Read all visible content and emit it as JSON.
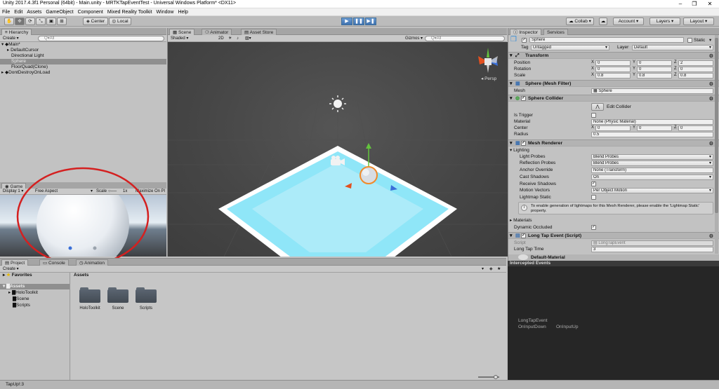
{
  "window": {
    "title": "Unity 2017.4.3f1 Personal (64bit) - Main.unity - MRTKTapEventTest - Universal Windows Platform* <DX11>"
  },
  "menu": [
    "File",
    "Edit",
    "Assets",
    "GameObject",
    "Component",
    "Mixed Reality Toolkit",
    "Window",
    "Help"
  ],
  "toolbar": {
    "center": "Center",
    "local": "Local",
    "collab": "Collab",
    "account": "Account",
    "layers": "Layers",
    "layout": "Layout"
  },
  "hierarchy": {
    "tab": "Hierarchy",
    "create": "Create",
    "search_placeholder": "Q▾All",
    "items": [
      {
        "label": "Main*",
        "indent": 0,
        "expanded": true
      },
      {
        "label": "DefaultCursor",
        "indent": 1,
        "collapsed": true
      },
      {
        "label": "Directional Light",
        "indent": 1
      },
      {
        "label": "Sphere",
        "indent": 1,
        "selected": true
      },
      {
        "label": "FloorQuad(Clone)",
        "indent": 1
      },
      {
        "label": "DontDestroyOnLoad",
        "indent": 0,
        "collapsed": true
      }
    ]
  },
  "scene": {
    "tabs": [
      "Scene",
      "Animator",
      "Asset Store"
    ],
    "shaded": "Shaded",
    "mode2d": "2D",
    "gizmos": "Gizmos",
    "search_placeholder": "Q▾All",
    "persp": "Persp"
  },
  "game": {
    "tab": "Game",
    "display": "Display 1",
    "aspect": "Free Aspect",
    "scale_label": "Scale",
    "scale_value": "1x",
    "maximize": "Maximize On Pl"
  },
  "project": {
    "tabs": [
      "Project",
      "Console",
      "Animation"
    ],
    "create": "Create",
    "favorites": "Favorites",
    "assets": "Assets",
    "tree": [
      "HoloToolkit",
      "Scene",
      "Scripts"
    ],
    "breadcrumb": "Assets",
    "folders": [
      "HoloToolkit",
      "Scene",
      "Scripts"
    ]
  },
  "inspector": {
    "tabs": [
      "Inspector",
      "Services"
    ],
    "object_name": "Sphere",
    "static_label": "Static",
    "tag_label": "Tag",
    "tag_value": "Untagged",
    "layer_label": "Layer",
    "layer_value": "Default",
    "transform": {
      "title": "Transform",
      "position": {
        "label": "Position",
        "x": "0",
        "y": "0",
        "z": "2"
      },
      "rotation": {
        "label": "Rotation",
        "x": "0",
        "y": "0",
        "z": "0"
      },
      "scale": {
        "label": "Scale",
        "x": "0.8",
        "y": "0.8",
        "z": "0.8"
      }
    },
    "mesh_filter": {
      "title": "Sphere (Mesh Filter)",
      "mesh_label": "Mesh",
      "mesh_value": "Sphere"
    },
    "sphere_collider": {
      "title": "Sphere Collider",
      "edit_collider": "Edit Collider",
      "is_trigger": "Is Trigger",
      "material_label": "Material",
      "material_value": "None (Physic Material)",
      "center_label": "Center",
      "center": {
        "x": "0",
        "y": "0",
        "z": "0"
      },
      "radius_label": "Radius",
      "radius_value": "0.5"
    },
    "mesh_renderer": {
      "title": "Mesh Renderer",
      "lighting": "Lighting",
      "light_probes_label": "Light Probes",
      "light_probes_value": "Blend Probes",
      "reflection_probes_label": "Reflection Probes",
      "reflection_probes_value": "Blend Probes",
      "anchor_override_label": "Anchor Override",
      "anchor_override_value": "None (Transform)",
      "cast_shadows_label": "Cast Shadows",
      "cast_shadows_value": "On",
      "receive_shadows_label": "Receive Shadows",
      "motion_vectors_label": "Motion Vectors",
      "motion_vectors_value": "Per Object Motion",
      "lightmap_static_label": "Lightmap Static",
      "info": "To enable generation of lightmaps for this Mesh Renderer, please enable the 'Lightmap Static' property.",
      "materials": "Materials",
      "dynamic_occluded": "Dynamic Occluded"
    },
    "long_tap": {
      "title": "Long Tap Event (Script)",
      "script_label": "Script",
      "script_value": "LongTapEvent",
      "long_tap_time_label": "Long Tap Time",
      "long_tap_time_value": "3"
    },
    "default_material": "Default-Material"
  },
  "intercepted": {
    "title": "Intercepted Events",
    "node_title": "LongTapEvent",
    "events": [
      "OnInputDown",
      "OnInputUp"
    ]
  },
  "status": {
    "text": "TapUp!:3"
  },
  "colors": {
    "accent": "#4a7fc1",
    "annotation": "#d42020",
    "floor": "#7fe3f7"
  }
}
